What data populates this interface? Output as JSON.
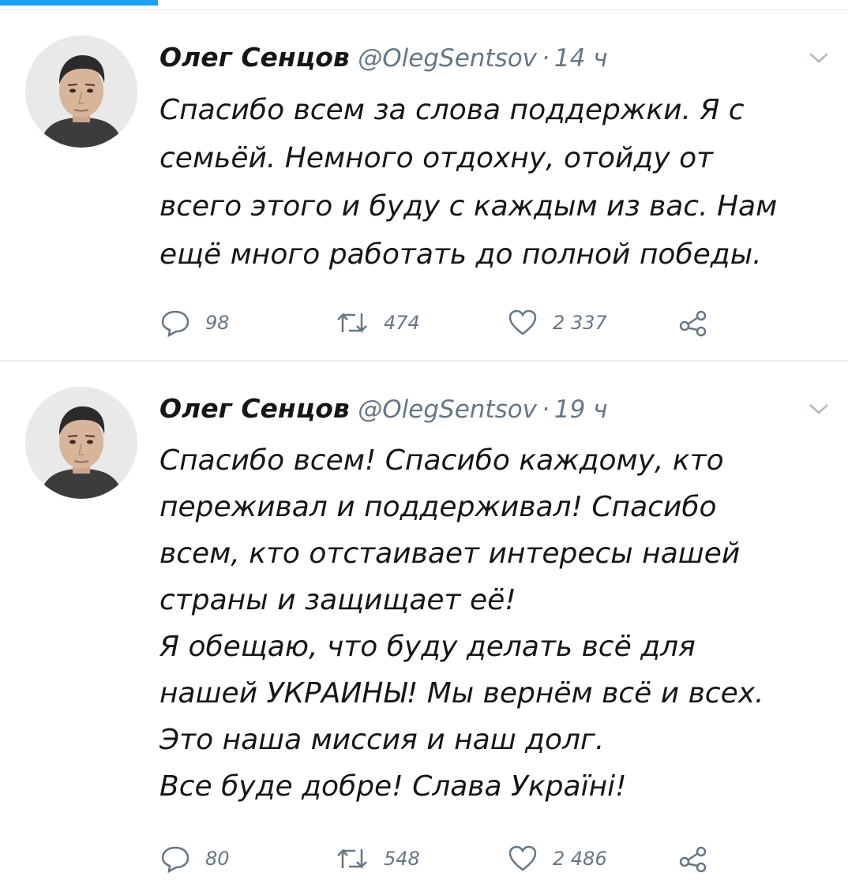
{
  "tweets": [
    {
      "author_name": "Олег Сенцов",
      "handle": "@OlegSentsov",
      "separator": "·",
      "time": "14 ч",
      "text": "Спасибо всем за слова поддержки. Я с\nсемьёй. Немного отдохну, отойду от\nвсего этого и буду с каждым из вас. Нам\nещё много работать до полной победы.",
      "replies": "98",
      "retweets": "474",
      "likes": "2 337"
    },
    {
      "author_name": "Олег Сенцов",
      "handle": "@OlegSentsov",
      "separator": "·",
      "time": "19 ч",
      "text": "Спасибо всем! Спасибо каждому, кто\nпереживал и поддерживал! Спасибо\nвсем, кто отстаивает интересы нашей\nстраны и защищает её!\nЯ обещаю, что буду делать всё для\nнашей УКРАИНЫ! Мы вернём всё и всех.\nЭто наша миссия и наш долг.\nВсе буде добре! Слава Україні!",
      "replies": "80",
      "retweets": "548",
      "likes": "2 486"
    }
  ],
  "colors": {
    "accent": "#1da1f2",
    "text": "#14171a",
    "secondary": "#657786",
    "divider": "#e6ecf0"
  },
  "icons": [
    "reply-icon",
    "retweet-icon",
    "like-icon",
    "share-icon",
    "chevron-down-icon"
  ]
}
